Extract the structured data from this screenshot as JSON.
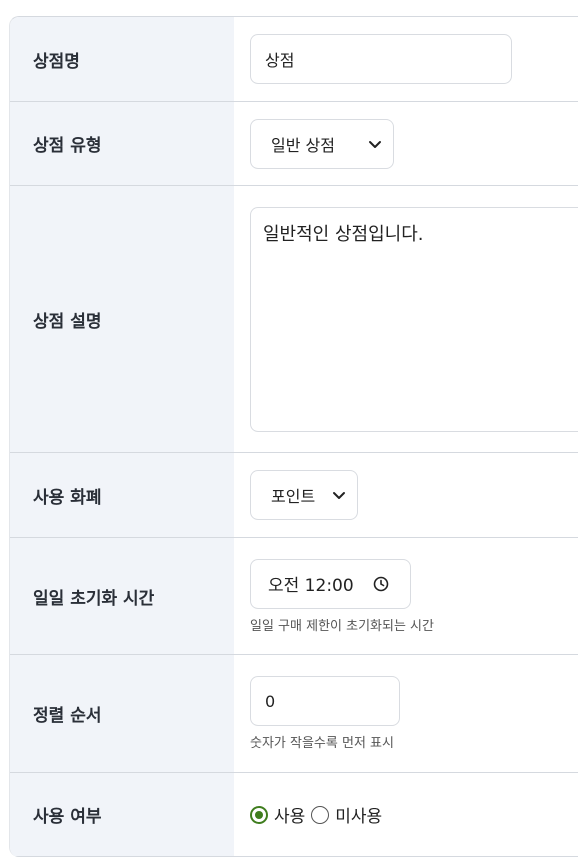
{
  "form": {
    "shop_name": {
      "label": "상점명",
      "value": "상점"
    },
    "shop_type": {
      "label": "상점 유형",
      "selected": "일반 상점"
    },
    "shop_description": {
      "label": "상점 설명",
      "value": "일반적인 상점입니다."
    },
    "currency": {
      "label": "사용 화폐",
      "selected": "포인트"
    },
    "daily_reset": {
      "label": "일일 초기화 시간",
      "value": "오전 12:00",
      "help": "일일 구매 제한이 초기화되는 시간"
    },
    "sort_order": {
      "label": "정렬 순서",
      "value": "0",
      "help": "숫자가 작을수록 먼저 표시"
    },
    "enabled": {
      "label": "사용 여부",
      "options": [
        "사용",
        "미사용"
      ],
      "selected": "사용"
    }
  },
  "colors": {
    "label_bg": "#f1f4f9",
    "border": "#d5d9df",
    "radio_accent": "#3f7d1e"
  },
  "icons": {
    "select_arrow": "chevron-down-icon",
    "time": "clock-icon"
  }
}
